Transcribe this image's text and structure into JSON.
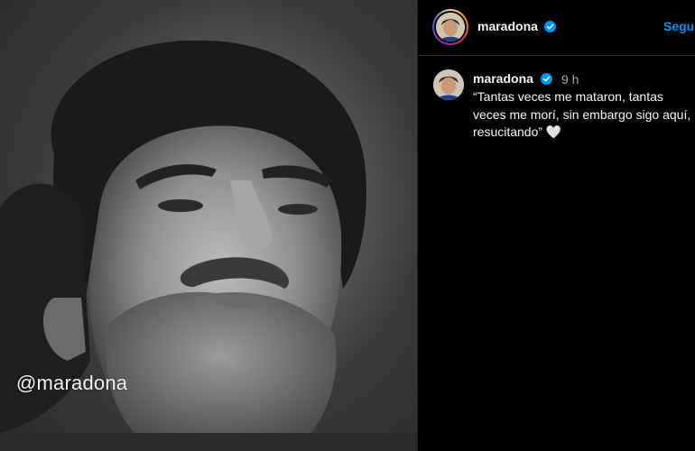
{
  "photo": {
    "watermark": "@maradona"
  },
  "header": {
    "username": "maradona",
    "follow_label": "Seguir"
  },
  "comment": {
    "username": "maradona",
    "time": "9 h",
    "caption": "“Tantas veces me mataron, tantas veces me morí, sin embargo sigo aquí, resucitando” 🤍"
  },
  "colors": {
    "accent": "#0095f6",
    "background": "#000000",
    "text": "#f5f5f5",
    "muted": "#a8a8a8"
  },
  "icons": {
    "verified": "verified-badge-icon",
    "heart": "white-heart-emoji"
  }
}
